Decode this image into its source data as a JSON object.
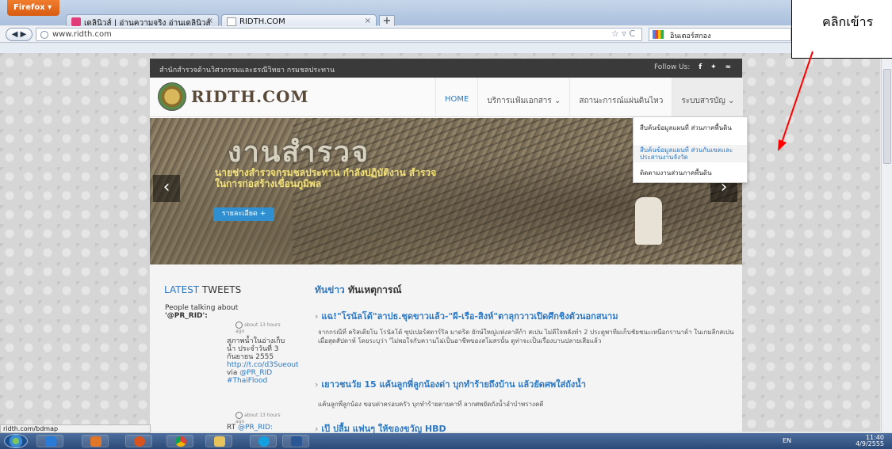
{
  "browser": {
    "menu_label": "Firefox",
    "tabs": [
      {
        "title": "เดลินิวส์ | อ่านความจริง อ่านเดลินิวส์",
        "close": "×"
      },
      {
        "title": "RIDTH.COM",
        "close": "×"
      }
    ],
    "new_tab": "+",
    "back_forward": "◀ ▶",
    "url": "www.ridth.com",
    "url_icons": "☆ ▿ C",
    "search_placeholder": "อินเตอร์สกอง",
    "status_url": "ridth.com/bdmap"
  },
  "site": {
    "top_strip": "สำนักสำรวจด้านวิศวกรรมและธรณีวิทยา กรมชลประทาน",
    "follow_label": "Follow Us:",
    "social": [
      "f",
      "✦",
      "≈"
    ],
    "logo_text": "RIDTH.COM",
    "menu": [
      {
        "label": "HOME",
        "state": "active"
      },
      {
        "label": "บริการแฟ้มเอกสาร ⌄",
        "state": "normal"
      },
      {
        "label": "สถานะการณ์แผ่นดินไหว",
        "state": "normal"
      },
      {
        "label": "ระบบสารบัญ ⌄",
        "state": "open"
      }
    ],
    "dropdown": [
      "สืบค้นข้อมูลแผนที่ ส่วนภาคพื้นดิน",
      "สืบค้นข้อมูลแผนที่ ส่วนกันเขตและประสานงานจังวัด",
      "ติดตามงานส่วนภาคพื้นดิน"
    ],
    "hero": {
      "title": "งานสำรวจ",
      "caption": "นายช่างสำรวจกรมชลประทาน กำลังปฏิบัติงาน สำรวจในการก่อสร้างเขื่อนภูมิพล",
      "button": "รายละเอียด +",
      "prev": "‹",
      "next": "›"
    },
    "tweets": {
      "head_accent": "LATEST",
      "head_rest": " TWEETS",
      "talking": "People talking about",
      "handle": "'@PR_RID':",
      "items": [
        {
          "time": "about 13 hours ago",
          "text": "สภาพน้ำในอ่างเก็บน้ำ ประจำวันที่ 3 กันยายน 2555 ",
          "link": "http://t.co/d3Sueout",
          "via": " via ",
          "user": "@PR_RID",
          "tag": "#ThaiFlood"
        },
        {
          "time": "about 13 hours ago",
          "text": "RT ",
          "link": "",
          "via": "",
          "user": "@PR_RID:",
          "tag": ""
        }
      ]
    },
    "news": {
      "head_accent": "ทันข่าว",
      "head_rest": " ทันเหตุการณ์",
      "items": [
        {
          "title": "แฉ!\"โรนัลโด้\"ลาปธ.ชุดขาวแล้ว-\"ผี-เรือ-สิงห์\"ตาลุกวาวเปิดศึกชิงตัวนอกสนาม",
          "body": "จากกรณีที่ คริสเตียโน โรนัลโด้ ซุปเปอร์สตาร์ริล มาดริด ยักษ์ใหญ่แห่งลาลีก้า สเปน ไม่ดีใจหลังทำ 2 ประตูพาทีมเก็บชัยชนะเหนือกรานาด้า ในเกมลีกสเปน เมื่อสุดสัปดาห์ โดยระบุว่า 'ไม่พอใจกับความไม่เป็นอาชีพของสโมสรนั้น ดูท่าจะเป็นเรื่องบานปลายเสียแล้ว"
        },
        {
          "title": "เยาวชนวัย 15 แค้นลูกพี่ลูกน้องด่า บุกทำร้ายถึงบ้าน แล้วยัดศพใส่ถังน้ำ",
          "body": "แค้นลูกพี่ลูกน้อง ขอบด่าครอบครัว บุกทำร้ายตายคาที่ ลากศพยัดถังน้ำอำบำพรางคดี"
        },
        {
          "title": "เป๊ ปลื้ม แฟนๆ ให้ของขวัญ HBD",
          "body": ""
        }
      ]
    }
  },
  "taskbar": {
    "apps": [
      "ie",
      "media",
      "firefox",
      "chrome",
      "explorer",
      "skype",
      "word"
    ],
    "lang": "EN",
    "time": "11:40",
    "date": "4/9/2555"
  },
  "annotation": {
    "callout_text": "คลิกเข้าร",
    "arrow_color": "#ff0000"
  }
}
